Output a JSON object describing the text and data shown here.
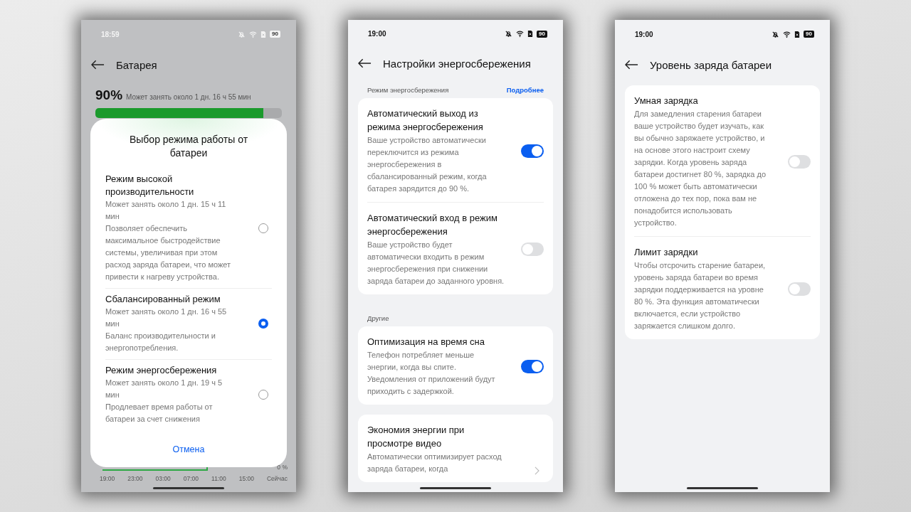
{
  "phones": [
    {
      "kind": "battery_sheet",
      "status_bar": {
        "time": "18:59",
        "battery": "90"
      },
      "header": {
        "title": "Батарея"
      },
      "summary": {
        "percent": "90%",
        "estimate": "Может занять около 1 дн. 16 ч 55 мин"
      },
      "battery_bar": {
        "level": 0.9
      },
      "chart_axis": {
        "y_label": "0 %",
        "x_labels": [
          "19:00",
          "23:00",
          "03:00",
          "07:00",
          "11:00",
          "15:00",
          "Сейчас"
        ]
      },
      "sheet": {
        "title": "Выбор режима работы от батареи",
        "cancel": "Отмена",
        "options": [
          {
            "title": "Режим высокой производительности",
            "duration": "Может занять около 1 дн. 15 ч 11 мин",
            "description": "Позволяет обеспечить максимальное быстродействие системы, увеличивая при этом расход заряда батареи, что может привести к нагреву устройства.",
            "selected": false
          },
          {
            "title": "Сбалансированный режим",
            "duration": "Может занять около 1 дн. 16 ч 55 мин",
            "description": "Баланс производительности и энергопотребления.",
            "selected": true
          },
          {
            "title": "Режим энергосбережения",
            "duration": "Может занять около 1 дн. 19 ч 5 мин",
            "description": "Продлевает время работы от батареи за счет снижения",
            "selected": false
          }
        ]
      }
    },
    {
      "kind": "settings",
      "status_bar": {
        "time": "19:00",
        "battery": "90"
      },
      "header": {
        "title": "Настройки энергосбережения"
      },
      "sections": [
        {
          "label": "Режим энергосбережения",
          "link": "Подробнее",
          "items": [
            {
              "kind": "toggle",
              "title": "Автоматический выход из режима энергосбережения",
              "description": "Ваше устройство автоматически переключится из режима энергосбережения в сбалансированный режим, когда батарея зарядится до 90 %.",
              "on": true
            },
            {
              "kind": "toggle",
              "title": "Автоматический вход в режим энергосбережения",
              "description": "Ваше устройство будет автоматически входить в режим энергосбережения при снижении заряда батареи до заданного уровня.",
              "on": false
            }
          ]
        },
        {
          "label": "Другие",
          "items": [
            {
              "kind": "toggle",
              "title": "Оптимизация на время сна",
              "description": "Телефон потребляет меньше энергии, когда вы спите. Уведомления от приложений будут приходить с задержкой.",
              "on": true
            }
          ]
        },
        {
          "items": [
            {
              "kind": "link",
              "title": "Экономия энергии при просмотре видео",
              "description": "Автоматически оптимизирует расход заряда батареи, когда"
            }
          ]
        }
      ]
    },
    {
      "kind": "settings",
      "status_bar": {
        "time": "19:00",
        "battery": "90"
      },
      "header": {
        "title": "Уровень заряда батареи"
      },
      "sections": [
        {
          "items": [
            {
              "kind": "toggle",
              "title": "Умная зарядка",
              "description": "Для замедления старения батареи ваше устройство будет изучать, как вы обычно заряжаете устройство, и на основе этого настроит схему зарядки. Когда уровень заряда батареи достигнет 80 %, зарядка до 100 % может быть автоматически отложена до тех пор, пока вам не понадобится использовать устройство.",
              "on": false
            },
            {
              "kind": "toggle",
              "title": "Лимит зарядки",
              "description": "Чтобы отсрочить старение батареи, уровень заряда батареи во время зарядки поддерживается на уровне 80 %. Эта функция автоматически включается, если устройство заряжается слишком долго.",
              "on": false
            }
          ]
        }
      ]
    }
  ]
}
